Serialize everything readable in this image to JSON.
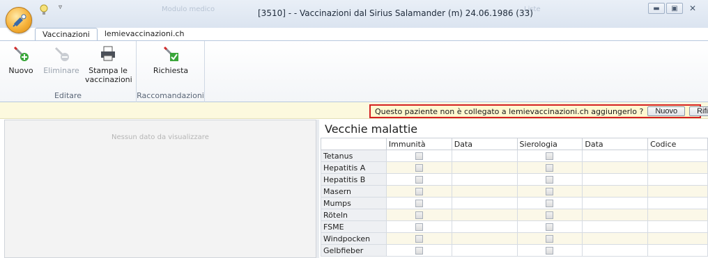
{
  "window": {
    "title": "[3510] - - Vaccinazioni dal Sirius Salamander (m) 24.06.1986 (33)",
    "ghost_left": "Modulo medico",
    "ghost_right": "Liste"
  },
  "tabs": [
    {
      "label": "Vaccinazioni",
      "active": true
    },
    {
      "label": "lemievaccinazioni.ch",
      "active": false
    }
  ],
  "ribbon": {
    "groups": [
      {
        "label": "Editare",
        "buttons": [
          {
            "label": "Nuovo",
            "icon": "syringe-plus-icon",
            "enabled": true
          },
          {
            "label": "Eliminare",
            "icon": "syringe-minus-icon",
            "enabled": false
          },
          {
            "label": "Stampa le vaccinazioni",
            "line1": "Stampa le",
            "line2": "vaccinazioni",
            "icon": "printer-icon",
            "enabled": true
          }
        ]
      },
      {
        "label": "Raccomandazioni",
        "buttons": [
          {
            "label": "Richiesta",
            "icon": "syringe-check-icon",
            "enabled": true
          }
        ]
      }
    ]
  },
  "notification": {
    "text": "Questo paziente non è collegato a lemievaccinazioni.ch aggiungerlo ?",
    "accept_label": "Nuovo",
    "reject_label": "Rifiutare"
  },
  "left_panel": {
    "empty_text": "Nessun dato da visualizzare"
  },
  "table": {
    "title": "Vecchie malattie",
    "columns": [
      "",
      "Immunità",
      "Data",
      "Sierologia",
      "Data",
      "Codice"
    ],
    "rows": [
      {
        "name": "Tetanus",
        "immunita": false,
        "sierologia": false
      },
      {
        "name": "Hepatitis A",
        "immunita": false,
        "sierologia": false
      },
      {
        "name": "Hepatitis B",
        "immunita": false,
        "sierologia": false
      },
      {
        "name": "Masern",
        "immunita": false,
        "sierologia": false
      },
      {
        "name": "Mumps",
        "immunita": false,
        "sierologia": false
      },
      {
        "name": "Röteln",
        "immunita": false,
        "sierologia": false
      },
      {
        "name": "FSME",
        "immunita": false,
        "sierologia": false
      },
      {
        "name": "Windpocken",
        "immunita": false,
        "sierologia": false
      },
      {
        "name": "Gelbfieber",
        "immunita": false,
        "sierologia": false
      }
    ]
  }
}
